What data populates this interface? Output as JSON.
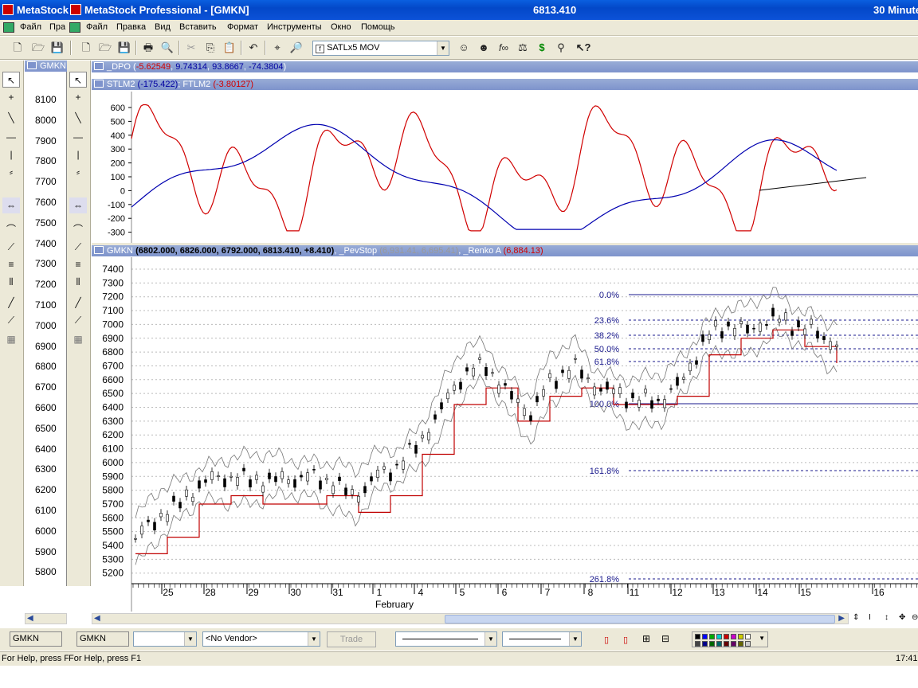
{
  "titlebar": {
    "app1": "MetaStock",
    "app2": "MetaStock Professional - [GMKN]",
    "price": "6813.410",
    "interval": "30 Minute"
  },
  "menu": [
    "Файл",
    "Пра",
    "Файл",
    "Правка",
    "Вид",
    "Вставить",
    "Формат",
    "Инструменты",
    "Окно",
    "Помощь"
  ],
  "toolbar": {
    "indicator_select": "SATLx5 MOV"
  },
  "left_chart": {
    "title": "GMKN",
    "scale": [
      "8100",
      "8000",
      "7900",
      "7800",
      "7700",
      "7600",
      "7500",
      "7400",
      "7300",
      "7200",
      "7100",
      "7000",
      "6900",
      "6800",
      "6700",
      "6600",
      "6500",
      "6400",
      "6300",
      "6200",
      "6100",
      "6000",
      "5900",
      "5800"
    ]
  },
  "dpo_header": {
    "name": "_DPO",
    "v1": "-5.62549",
    "v2": "9.74314",
    "v3": "93.8667",
    "v4": "-74.3804"
  },
  "stlm_header": {
    "name1": "STLM2",
    "v1": "(-175.422)",
    "name2": "FTLM2",
    "v2": "(-3.80127)"
  },
  "osc_scale": [
    "600",
    "500",
    "400",
    "300",
    "200",
    "100",
    "0",
    "-100",
    "-200",
    "-300"
  ],
  "price_header": {
    "name": "GMKN",
    "values": "(6802.000, 6826.000, 6792.000, 6813.410, +8.410)",
    "ind1": "_PevStop",
    "ind1_vals": "(6,931.41, 6,695.41)",
    "ind2": "_Renko A",
    "ind2_val": "(6,884.13)"
  },
  "price_scale": [
    "7400",
    "7300",
    "7200",
    "7100",
    "7000",
    "6900",
    "6800",
    "6700",
    "6600",
    "6500",
    "6400",
    "6300",
    "6200",
    "6100",
    "6000",
    "5900",
    "5800",
    "5700",
    "5600",
    "5500",
    "5400",
    "5300",
    "5200"
  ],
  "fib_levels": [
    "0.0%",
    "23.6%",
    "38.2%",
    "50.0%",
    "61.8%",
    "100.0%",
    "161.8%",
    "261.8%"
  ],
  "date_axis": {
    "days": [
      "25",
      "28",
      "29",
      "30",
      "31",
      "1",
      "4",
      "5",
      "6",
      "7",
      "8",
      "11",
      "12",
      "13",
      "14",
      "15",
      "16"
    ],
    "month": "February"
  },
  "bottom": {
    "symbol_left": "GMKN",
    "symbol_right": "GMKN",
    "vendor": "<No Vendor>",
    "trade": "Trade"
  },
  "status": {
    "left": "For Help, press F",
    "help": "For Help, press F1",
    "time": "17:41"
  },
  "colors": {
    "red_line": "#d00000",
    "blue_line": "#0000b0",
    "fib_line": "#1a1a8c",
    "header_bg": "#8497cf"
  }
}
